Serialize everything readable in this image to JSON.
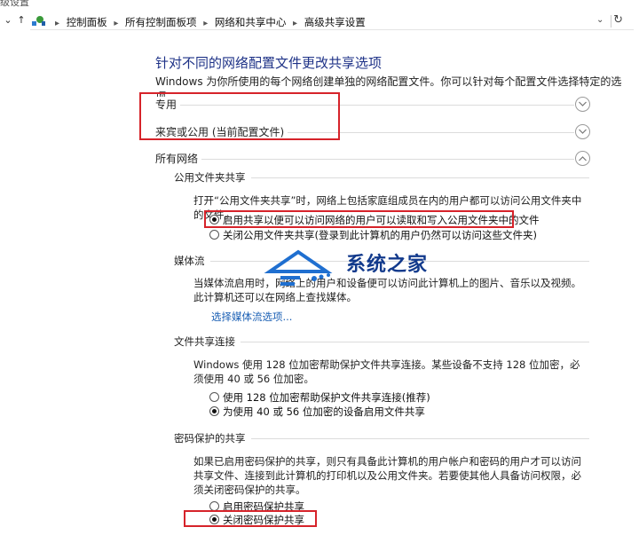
{
  "window": {
    "title_fragment": "级设置"
  },
  "address_bar": {
    "crumbs": [
      "控制面板",
      "所有控制面板项",
      "网络和共享中心",
      "高级共享设置"
    ]
  },
  "page": {
    "title": "针对不同的网络配置文件更改共享选项",
    "description": "Windows 为你所使用的每个网络创建单独的网络配置文件。你可以针对每个配置文件选择特定的选项。"
  },
  "profiles": {
    "private": "专用",
    "guest_public": "来宾或公用 (当前配置文件)",
    "all_networks": "所有网络"
  },
  "public_folder": {
    "heading": "公用文件夹共享",
    "text": "打开“公用文件夹共享”时，网络上包括家庭组成员在内的用户都可以访问公用文件夹中的文件。",
    "option_on": "启用共享以便可以访问网络的用户可以读取和写入公用文件夹中的文件",
    "option_off": "关闭公用文件夹共享(登录到此计算机的用户仍然可以访问这些文件夹)",
    "selected": "on"
  },
  "media": {
    "heading": "媒体流",
    "text": "当媒体流启用时，网络上的用户和设备便可以访问此计算机上的图片、音乐以及视频。此计算机还可以在网络上查找媒体。",
    "link": "选择媒体流选项..."
  },
  "file_sharing": {
    "heading": "文件共享连接",
    "text": "Windows 使用 128 位加密帮助保护文件共享连接。某些设备不支持 128 位加密，必须使用 40 或 56 位加密。",
    "option_128": "使用 128 位加密帮助保护文件共享连接(推荐)",
    "option_40_56": "为使用 40 或 56 位加密的设备启用文件共享",
    "selected": "40_56"
  },
  "password": {
    "heading": "密码保护的共享",
    "text": "如果已启用密码保护的共享，则只有具备此计算机的用户帐户和密码的用户才可以访问共享文件、连接到此计算机的打印机以及公用文件夹。若要使其他人具备访问权限，必须关闭密码保护的共享。",
    "option_on": "启用密码保护共享",
    "option_off": "关闭密码保护共享",
    "selected": "off"
  },
  "watermark": {
    "text": "系统之家"
  },
  "colors": {
    "title": "#1e3287",
    "link": "#1a5fb4",
    "highlight": "#d6232a"
  },
  "icons": [
    "control-panel-icon",
    "chevron-down-icon",
    "chevron-up-icon",
    "refresh-icon"
  ]
}
